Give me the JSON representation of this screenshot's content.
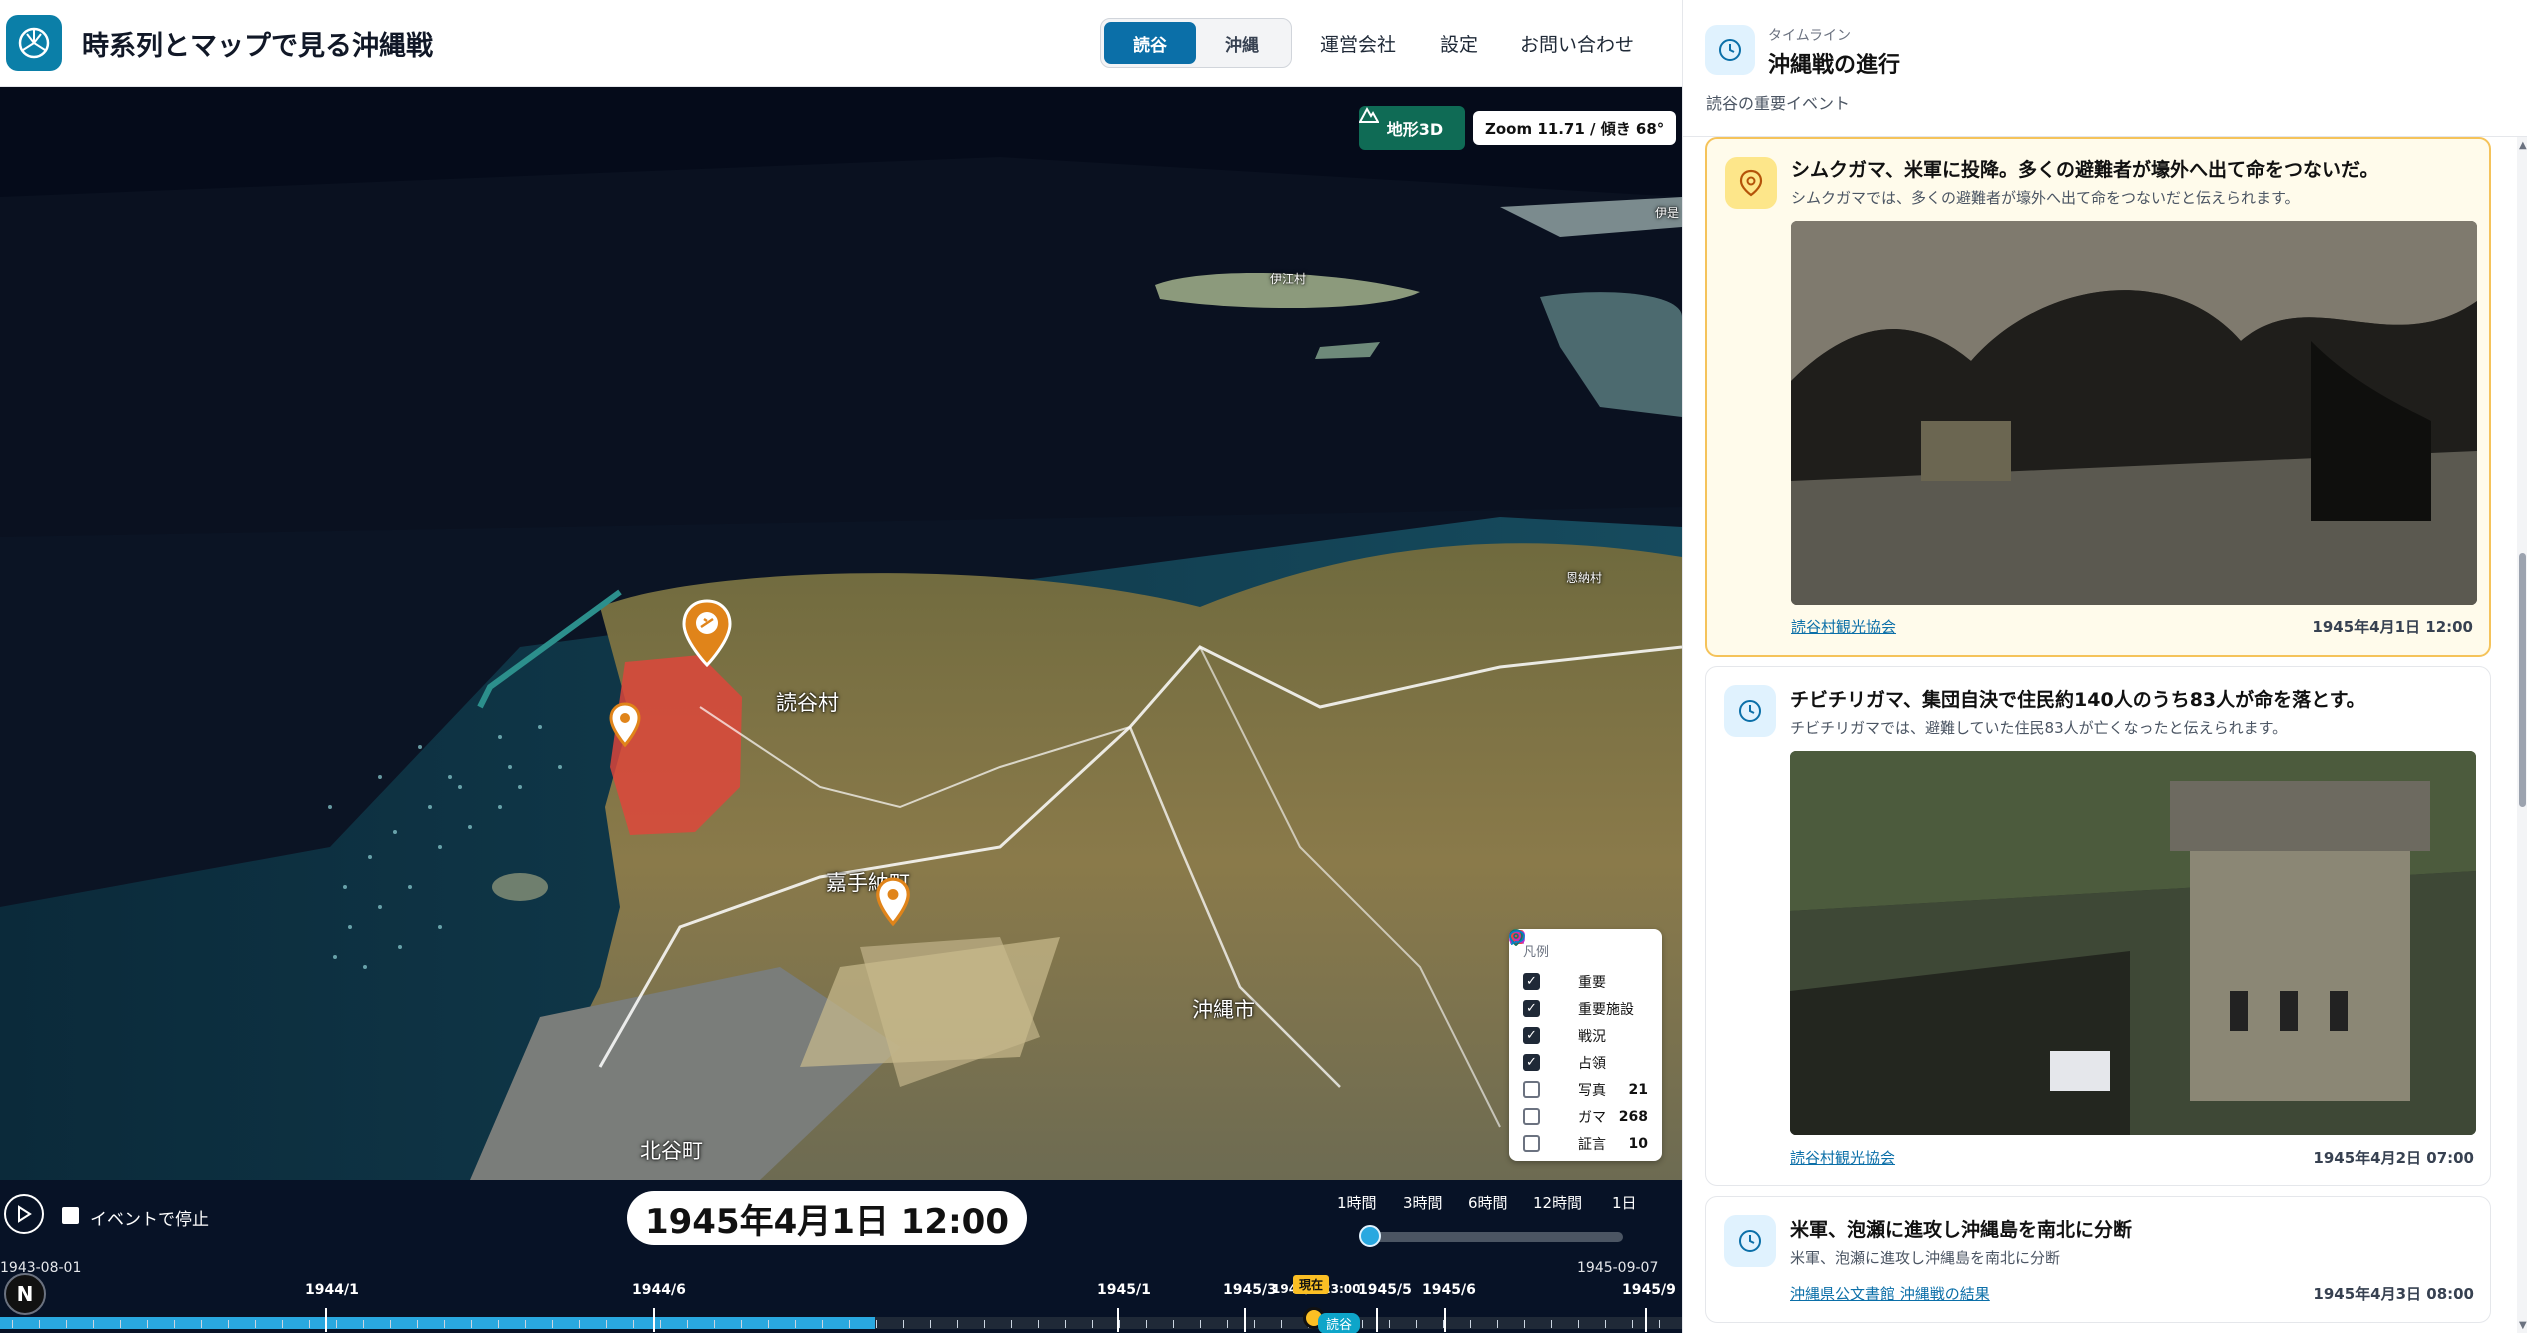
{
  "app": {
    "title": "時系列とマップで見る沖縄戦"
  },
  "header": {
    "region_tabs": [
      {
        "label": "読谷",
        "active": true
      },
      {
        "label": "沖縄",
        "active": false
      }
    ],
    "nav": {
      "company": "運営会社",
      "settings": "設定",
      "contact": "お問い合わせ"
    }
  },
  "map": {
    "terrain_label": "地形3D",
    "zoom_readout": "Zoom 11.71 / 傾き 68°",
    "places": {
      "yomitan": "読谷村",
      "kadena": "嘉手納町",
      "okinawa_city": "沖縄市",
      "chatan": "北谷町",
      "iejima": "伊江村",
      "onna": "恩納村",
      "ihe": "伊是"
    }
  },
  "legend": {
    "title": "凡例",
    "items": [
      {
        "label": "重要",
        "checked": true,
        "icon": "pin-icon",
        "color": "#e6951a",
        "count": ""
      },
      {
        "label": "重要施設",
        "checked": true,
        "icon": "building-icon",
        "color": "#a855f7",
        "count": ""
      },
      {
        "label": "戦況",
        "checked": true,
        "icon": "swords-icon",
        "color": "#ef4444",
        "count": ""
      },
      {
        "label": "占領",
        "checked": true,
        "icon": "occupied-square-icon",
        "color": "#ef4444",
        "count": ""
      },
      {
        "label": "写真",
        "checked": false,
        "icon": "camera-icon",
        "color": "#c026d3",
        "count": "21"
      },
      {
        "label": "ガマ",
        "checked": false,
        "icon": "cave-pin-icon",
        "color": "#0f766e",
        "count": "268"
      },
      {
        "label": "証言",
        "checked": false,
        "icon": "speech-icon",
        "color": "#0284c7",
        "count": "10"
      }
    ]
  },
  "timeline": {
    "stop_on_event_label": "イベントで停止",
    "stop_on_event_checked": false,
    "current_datetime": "1945年4月1日 12:00",
    "speeds": [
      "1時間",
      "3時間",
      "6時間",
      "12時間",
      "1日"
    ],
    "selected_speed": "1時間",
    "range_start": "1943-08-01",
    "range_end": "1945-09-07",
    "ticks": [
      "1944/1",
      "1944/6",
      "1945/1",
      "1945/3",
      "1945/4 23:00",
      "1945/5",
      "1945/6",
      "1945/9"
    ],
    "now_label": "現在",
    "current_region": "読谷",
    "progress": 0.52
  },
  "sidebar": {
    "kicker": "タイムライン",
    "title": "沖縄戦の進行",
    "subtitle": "読谷の重要イベント",
    "events": [
      {
        "title": "シムクガマ、米軍に投降。多くの避難者が壕外へ出て命をつないだ。",
        "desc": "シムクガマでは、多くの避難者が壕外へ出て命をつないだと伝えられます。",
        "source": "読谷村観光協会",
        "date": "1945年4月1日 12:00",
        "icon": "pin-icon",
        "highlighted": true
      },
      {
        "title": "チビチリガマ、集団自決で住民約140人のうち83人が命を落とす。",
        "desc": "チビチリガマでは、避難していた住民83人が亡くなったと伝えられます。",
        "source": "読谷村観光協会",
        "date": "1945年4月2日 07:00",
        "icon": "clock-icon",
        "highlighted": false
      },
      {
        "title": "米軍、泡瀬に進攻し沖縄島を南北に分断",
        "desc": "米軍、泡瀬に進攻し沖縄島を南北に分断",
        "source": "沖縄県公文書館 沖縄戦の結果",
        "date": "1945年4月3日 08:00",
        "icon": "clock-icon",
        "highlighted": false
      }
    ]
  }
}
